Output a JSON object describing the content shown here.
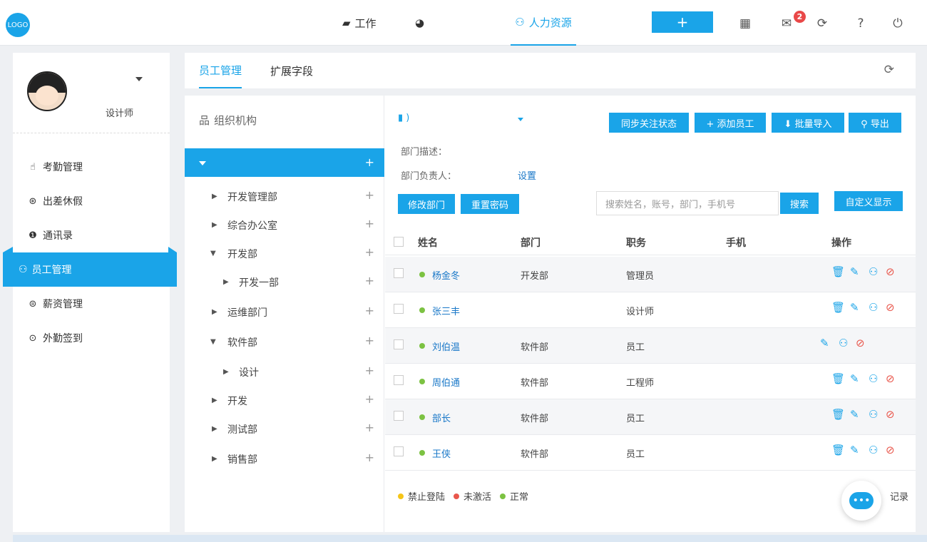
{
  "topbar": {
    "logo": "LOGO",
    "nav": [
      {
        "icon": "briefcase-icon",
        "glyph": "▰",
        "label": "工作"
      },
      {
        "icon": "pie-chart-icon",
        "glyph": "◕",
        "label": ""
      },
      {
        "icon": "people-icon",
        "glyph": "⚇",
        "label": "人力资源"
      }
    ],
    "add_glyph": "+",
    "mail_count": "2"
  },
  "sidebar": {
    "role": "设计师",
    "menu": [
      {
        "icon": "hand-icon",
        "glyph": "☝",
        "label": "考勤管理"
      },
      {
        "icon": "location-icon",
        "glyph": "⊛",
        "label": "出差休假"
      },
      {
        "icon": "contacts-icon",
        "glyph": "❶",
        "label": "通讯录"
      },
      {
        "icon": "employee-icon",
        "glyph": "⚇",
        "label": "员工管理"
      },
      {
        "icon": "salary-icon",
        "glyph": "⊜",
        "label": "薪资管理"
      },
      {
        "icon": "signin-icon",
        "glyph": "⊙",
        "label": "外勤签到"
      }
    ]
  },
  "tabs": [
    "员工管理",
    "扩展字段"
  ],
  "tree": {
    "title": "组织机构",
    "nodes": [
      {
        "label": "开发管理部",
        "expanded": false
      },
      {
        "label": "综合办公室",
        "expanded": false
      },
      {
        "label": "开发部",
        "expanded": true
      },
      {
        "label": "开发一部",
        "expanded": false
      },
      {
        "label": "运维部门",
        "expanded": false
      },
      {
        "label": "软件部",
        "expanded": true
      },
      {
        "label": "设计",
        "expanded": false
      },
      {
        "label": "开发",
        "expanded": false
      },
      {
        "label": "测试部",
        "expanded": false
      },
      {
        "label": "销售部",
        "expanded": false
      }
    ]
  },
  "dept": {
    "name": ")",
    "desc_label": "部门描述：",
    "head_label": "部门负责人：",
    "head_link": "设置"
  },
  "buttons": {
    "sync": "同步关注状态",
    "add_employee": "+ 添加员工",
    "import": "⬇ 批量导入",
    "export": "⚲ 导出",
    "edit_dept": "修改部门",
    "reset_pwd": "重置密码",
    "search": "搜索",
    "custom_display": "自定义显示"
  },
  "search": {
    "placeholder": "搜索姓名，账号，部门，手机号"
  },
  "table": {
    "headers": [
      "姓名",
      "部门",
      "职务",
      "手机",
      "操作"
    ],
    "rows": [
      {
        "name": "杨金冬",
        "dept": "开发部",
        "title": "管理员",
        "phone": "",
        "status": "正常",
        "delete": true
      },
      {
        "name": "张三丰",
        "dept": "",
        "title": "设计师",
        "phone": "",
        "status": "正常",
        "delete": true
      },
      {
        "name": "刘伯温",
        "dept": "软件部",
        "title": "员工",
        "phone": "",
        "status": "正常",
        "delete": false
      },
      {
        "name": "周伯通",
        "dept": "软件部",
        "title": "工程师",
        "phone": "",
        "status": "正常",
        "delete": true
      },
      {
        "name": "部长",
        "dept": "软件部",
        "title": "员工",
        "phone": "",
        "status": "正常",
        "delete": true
      },
      {
        "name": "王侠",
        "dept": "软件部",
        "title": "员工",
        "phone": "",
        "status": "正常",
        "delete": true
      }
    ]
  },
  "legend": [
    {
      "label": "禁止登陆",
      "color": "#f5c518"
    },
    {
      "label": "未激活",
      "color": "#e9574c"
    },
    {
      "label": "正常",
      "color": "#7cc242"
    }
  ],
  "records_text": "记录",
  "colors": {
    "accent": "#1aa4e8",
    "link": "#1a78c8",
    "action_red": "#e9574c"
  }
}
